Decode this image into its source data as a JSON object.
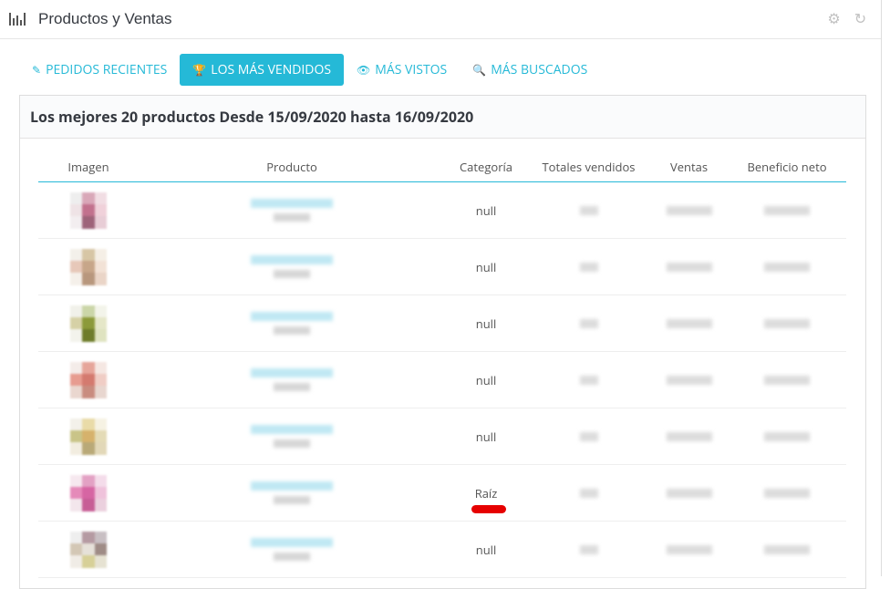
{
  "panel": {
    "title": "Productos y Ventas",
    "tools": [
      {
        "name": "gear-icon",
        "glyph": "⚙"
      },
      {
        "name": "refresh-icon",
        "glyph": "↻"
      }
    ]
  },
  "tabs": [
    {
      "label": "PEDIDOS RECIENTES",
      "icon": "✎",
      "active": false
    },
    {
      "label": "LOS MÁS VENDIDOS",
      "icon": "🏆",
      "active": true
    },
    {
      "label": "MÁS VISTOS",
      "icon": "👁",
      "active": false
    },
    {
      "label": "MÁS BUSCADOS",
      "icon": "🔍",
      "active": false
    }
  ],
  "box": {
    "title": "Los mejores 20 productos Desde 15/09/2020 hasta 16/09/2020"
  },
  "table": {
    "headers": [
      "Imagen",
      "Producto",
      "Categoría",
      "Totales vendidos",
      "Ventas",
      "Beneficio neto"
    ],
    "rows": [
      {
        "category": "null",
        "colors": [
          "#eee",
          "#d9a7b8",
          "#f1dde3",
          "#efe3e6",
          "#c2718d",
          "#f0d1da",
          "#f3eef0",
          "#9e6379",
          "#e8cdd6"
        ]
      },
      {
        "category": "null",
        "colors": [
          "#f3f0ea",
          "#d7c6a5",
          "#f5efe6",
          "#e7c8b9",
          "#c7a689",
          "#f2e2d6",
          "#f5f0ea",
          "#b8977d",
          "#ead5c7"
        ]
      },
      {
        "category": "null",
        "colors": [
          "#f1f1ea",
          "#cbd6a8",
          "#f3f4ea",
          "#d6d1a6",
          "#8c9a3a",
          "#e5e7c8",
          "#f3f3ec",
          "#6e7c2a",
          "#dfe3c0"
        ]
      },
      {
        "category": "null",
        "colors": [
          "#f4ece9",
          "#e6a59a",
          "#f5e7e2",
          "#e79c90",
          "#d47a6f",
          "#f0cdc5",
          "#ead7cf",
          "#c98c7f",
          "#e8d6cf"
        ]
      },
      {
        "category": "null",
        "colors": [
          "#f3f1ea",
          "#e9dba8",
          "#f6f2e3",
          "#c9c488",
          "#d6b26c",
          "#e4dbb6",
          "#f2ede0",
          "#b9a978",
          "#e2d8b8"
        ]
      },
      {
        "category": "Raíz",
        "colors": [
          "#f6e8ef",
          "#e3a1c4",
          "#f4dcea",
          "#e58ab9",
          "#d665a3",
          "#efc2db",
          "#f3e6ec",
          "#c75e96",
          "#ebd0de"
        ]
      },
      {
        "category": "null",
        "colors": [
          "#eee",
          "#b59aa2",
          "#c8bfc3",
          "#d3c7b5",
          "#e6e1d9",
          "#9f8c86",
          "#f0ece6",
          "#d7d098",
          "#e6e2d2"
        ]
      }
    ]
  }
}
